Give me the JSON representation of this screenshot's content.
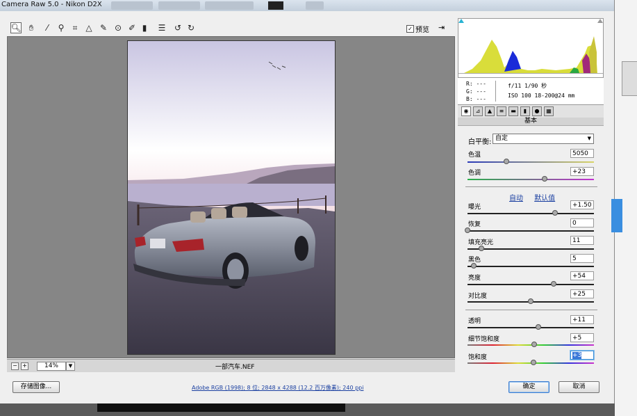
{
  "window": {
    "title": "Camera Raw 5.0 - Nikon D2X"
  },
  "toolbar": {
    "tools": [
      "zoom-icon",
      "hand-icon",
      "white-balance-icon",
      "color-sampler-icon",
      "crop-icon",
      "straighten-icon",
      "spot-removal-icon",
      "red-eye-icon",
      "adjustment-brush-icon",
      "graduated-filter-icon",
      "preferences-icon",
      "rotate-left-icon",
      "rotate-right-icon"
    ],
    "preview_label": "预览",
    "preview_checked": "✓"
  },
  "status": {
    "zoom_minus": "−",
    "zoom_plus": "+",
    "zoom": "14%",
    "filename": "一部汽车.NEF"
  },
  "info": {
    "r": "R:  ---",
    "g": "G:  ---",
    "b": "B:  ---",
    "exposure": "f/11   1/90 秒",
    "iso": "ISO 100  18-200@24 mm"
  },
  "panel": {
    "title": "基本",
    "wb_label": "白平衡:",
    "wb_value": "自定",
    "auto": "自动",
    "default": "默认值",
    "sliders": [
      {
        "label": "色温",
        "value": "5050",
        "pos": 0.31
      },
      {
        "label": "色调",
        "value": "+23",
        "pos": 0.61
      },
      {
        "label": "曝光",
        "value": "+1.50",
        "pos": 0.69
      },
      {
        "label": "恢复",
        "value": "0",
        "pos": 0.0
      },
      {
        "label": "填充亮光",
        "value": "11",
        "pos": 0.11
      },
      {
        "label": "黑色",
        "value": "5",
        "pos": 0.05
      },
      {
        "label": "亮度",
        "value": "+54",
        "pos": 0.68
      },
      {
        "label": "对比度",
        "value": "+25",
        "pos": 0.5
      },
      {
        "label": "透明",
        "value": "+11",
        "pos": 0.56
      },
      {
        "label": "细节饱和度",
        "value": "+5",
        "pos": 0.53
      },
      {
        "label": "饱和度",
        "value": "+3",
        "pos": 0.52
      }
    ]
  },
  "footer": {
    "save": "存储图像...",
    "workflow": "Adobe RGB (1998); 8 位; 2848 x 4288 (12.2 百万像素); 240 ppi",
    "ok": "确定",
    "cancel": "取消"
  },
  "colors": {
    "accent": "#3b7bd0",
    "link": "#1a3fa0"
  }
}
